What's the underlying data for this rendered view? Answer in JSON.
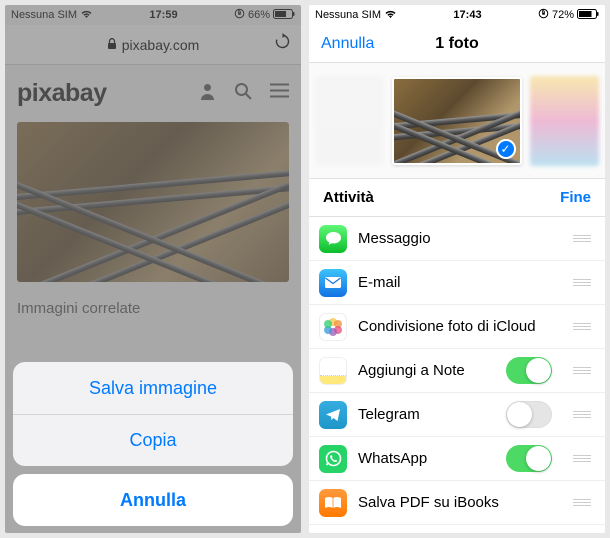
{
  "screen1": {
    "status": {
      "carrier": "Nessuna SIM",
      "time": "17:59",
      "orientation_lock": true,
      "battery_pct": "66%"
    },
    "address_bar": {
      "domain": "pixabay.com",
      "lock_icon": "lock-icon",
      "reload_icon": "reload-icon"
    },
    "site": {
      "brand": "pixabay",
      "related_heading": "Immagini correlate"
    },
    "action_sheet": {
      "items": [
        {
          "label": "Salva immagine"
        },
        {
          "label": "Copia"
        }
      ],
      "cancel": "Annulla"
    }
  },
  "screen2": {
    "status": {
      "carrier": "Nessuna SIM",
      "time": "17:43",
      "orientation_lock": true,
      "battery_pct": "72%"
    },
    "nav": {
      "left": "Annulla",
      "title": "1 foto"
    },
    "section": {
      "title": "Attività",
      "done": "Fine"
    },
    "activities": [
      {
        "icon": "message",
        "label": "Messaggio",
        "toggle": null
      },
      {
        "icon": "mail",
        "label": "E-mail",
        "toggle": null
      },
      {
        "icon": "photos",
        "label": "Condivisione foto di iCloud",
        "toggle": null
      },
      {
        "icon": "notes",
        "label": "Aggiungi a Note",
        "toggle": true
      },
      {
        "icon": "telegram",
        "label": "Telegram",
        "toggle": false
      },
      {
        "icon": "whatsapp",
        "label": "WhatsApp",
        "toggle": true
      },
      {
        "icon": "ibooks",
        "label": "Salva PDF su iBooks",
        "toggle": null
      }
    ]
  }
}
